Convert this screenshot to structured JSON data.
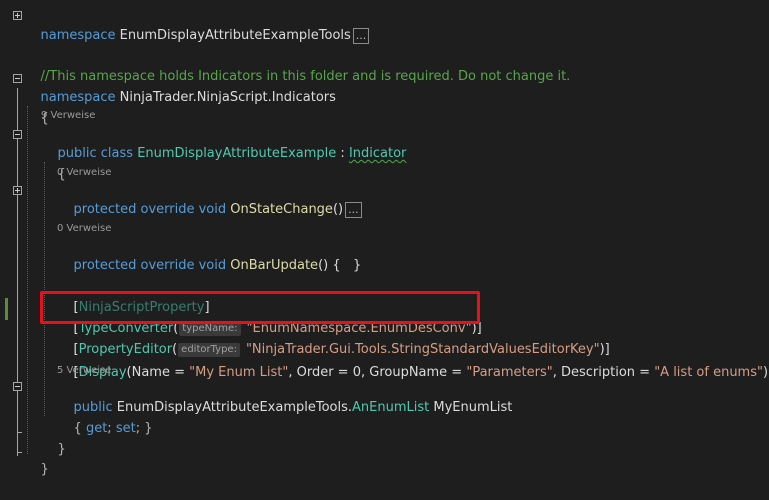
{
  "collapsed_marker": "...",
  "codelens": {
    "class_refs": "9 Verweise",
    "onstate_refs": "0 Verweise",
    "onbar_refs": "0 Verweise",
    "prop_refs": "5 Verweise"
  },
  "lines": {
    "ns1_kw": "namespace",
    "ns1_name": " EnumDisplayAttributeExampleTools",
    "comment": "//This namespace holds Indicators in this folder and is required. Do not change it.",
    "ns2_kw": "namespace",
    "ns2_name": " NinjaTrader.NinjaScript.Indicators",
    "open_brace": "{",
    "class_kw": "public class",
    "class_name": " EnumDisplayAttributeExample",
    "class_sep": " : ",
    "class_base": "Indicator",
    "class_open": "{",
    "onstate_kw": "protected override void",
    "onstate_name": " OnStateChange",
    "onstate_paren": "()",
    "onbar_kw": "protected override void",
    "onbar_name": " OnBarUpdate",
    "onbar_body": "() {   }",
    "attr1_open": "[",
    "attr1_name": "NinjaScriptProperty",
    "attr1_close": "]",
    "attr2_open": "[",
    "attr2_name": "TypeConverter",
    "attr2_paren": "(",
    "attr2_hint": "typeName:",
    "attr2_value": "\"EnumNamespace.EnumDesConv\"",
    "attr2_close": ")]",
    "attr3_open": "[",
    "attr3_name": "PropertyEditor",
    "attr3_paren": "(",
    "attr3_hint": "editorType:",
    "attr3_value": "\"NinjaTrader.Gui.Tools.StringStandardValuesEditorKey\"",
    "attr3_close": ")]",
    "attr4_open": "[",
    "attr4_name": "Display",
    "attr4_a": "(Name = ",
    "attr4_v1": "\"My Enum List\"",
    "attr4_b": ", Order = 0, GroupName = ",
    "attr4_v2": "\"Parameters\"",
    "attr4_c": ", Description = ",
    "attr4_v3": "\"A list of enums\"",
    "attr4_close": ")]",
    "prop_kw": "public",
    "prop_type_a": " EnumDisplayAttributeExampleTools.",
    "prop_type_b": "AnEnumList",
    "prop_name": " MyEnumList",
    "accessor_open": "{ ",
    "accessor_get": "get",
    "accessor_semi1": "; ",
    "accessor_set": "set",
    "accessor_semi2": "; }",
    "class_close": "}",
    "ns_close": "}"
  }
}
